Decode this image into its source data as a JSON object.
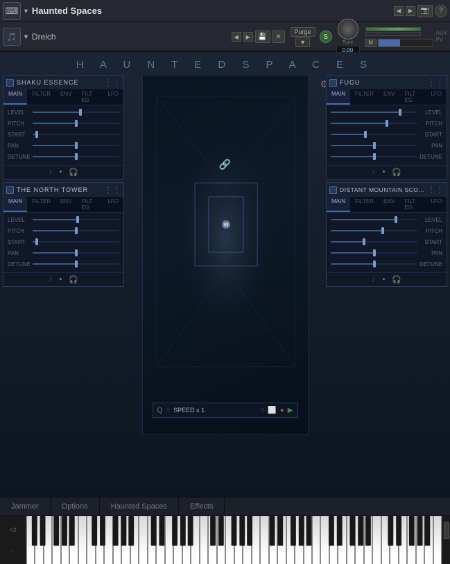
{
  "app": {
    "title": "Haunted Spaces",
    "instrument": "Dreich",
    "tune_label": "Tune",
    "tune_value": "0.00"
  },
  "header": {
    "buttons": {
      "camera": "📷",
      "question": "?",
      "s_btn": "S",
      "m_btn": "M",
      "purge": "Purge",
      "aux": "AUX",
      "pv": "PV"
    }
  },
  "main_title": "H A U N T E D     S P A C E S",
  "left_panels": [
    {
      "name": "SHAKU ESSENCE",
      "tabs": [
        "MAIN",
        "FILTER",
        "ENV",
        "FILT EG",
        "LFO"
      ],
      "active_tab": "MAIN",
      "sliders": [
        {
          "label": "LEVEL",
          "pct": 55
        },
        {
          "label": "PITCH",
          "pct": 50
        },
        {
          "label": "START",
          "pct": 5
        },
        {
          "label": "PAN",
          "pct": 50
        },
        {
          "label": "DETUNE",
          "pct": 50
        }
      ]
    },
    {
      "name": "THE NORTH TOWER",
      "tabs": [
        "MAIN",
        "FILTER",
        "ENV",
        "FILT EG",
        "LFO"
      ],
      "active_tab": "MAIN",
      "sliders": [
        {
          "label": "LEVEL",
          "pct": 52
        },
        {
          "label": "PITCH",
          "pct": 50
        },
        {
          "label": "START",
          "pct": 5
        },
        {
          "label": "PAN",
          "pct": 50
        },
        {
          "label": "DETUNE",
          "pct": 50
        }
      ]
    }
  ],
  "right_panels": [
    {
      "name": "FUGU",
      "tabs": [
        "MAIN",
        "FILTER",
        "ENV",
        "FILT EG",
        "LFO"
      ],
      "active_tab": "MAIN",
      "sliders": [
        {
          "label": "LEVEL",
          "pct": 80
        },
        {
          "label": "PITCH",
          "pct": 65
        },
        {
          "label": "START",
          "pct": 40
        },
        {
          "label": "PAN",
          "pct": 50
        },
        {
          "label": "DETUNE",
          "pct": 50
        }
      ]
    },
    {
      "name": "DISTANT MOUNTAIN SCOTLAND",
      "tabs": [
        "MAIN",
        "FILTER",
        "ENV",
        "FILT EG",
        "LFO"
      ],
      "active_tab": "MAIN",
      "sliders": [
        {
          "label": "LEVEL",
          "pct": 75
        },
        {
          "label": "PITCH",
          "pct": 60
        },
        {
          "label": "START",
          "pct": 38
        },
        {
          "label": "PAN",
          "pct": 50
        },
        {
          "label": "DETUNE",
          "pct": 50
        }
      ]
    }
  ],
  "transport": {
    "q_label": "Q",
    "speed_label": "SPEED x 1",
    "icons": [
      "≡",
      "Q",
      "≡",
      "⬜",
      "●",
      "▶"
    ]
  },
  "bottom_tabs": [
    {
      "label": "Jammer",
      "active": false
    },
    {
      "label": "Options",
      "active": false
    },
    {
      "label": "Haunted Spaces",
      "active": false
    },
    {
      "label": "Effects",
      "active": false
    }
  ],
  "piano": {
    "octave_plus2": "+2",
    "octave_minus": "-"
  }
}
